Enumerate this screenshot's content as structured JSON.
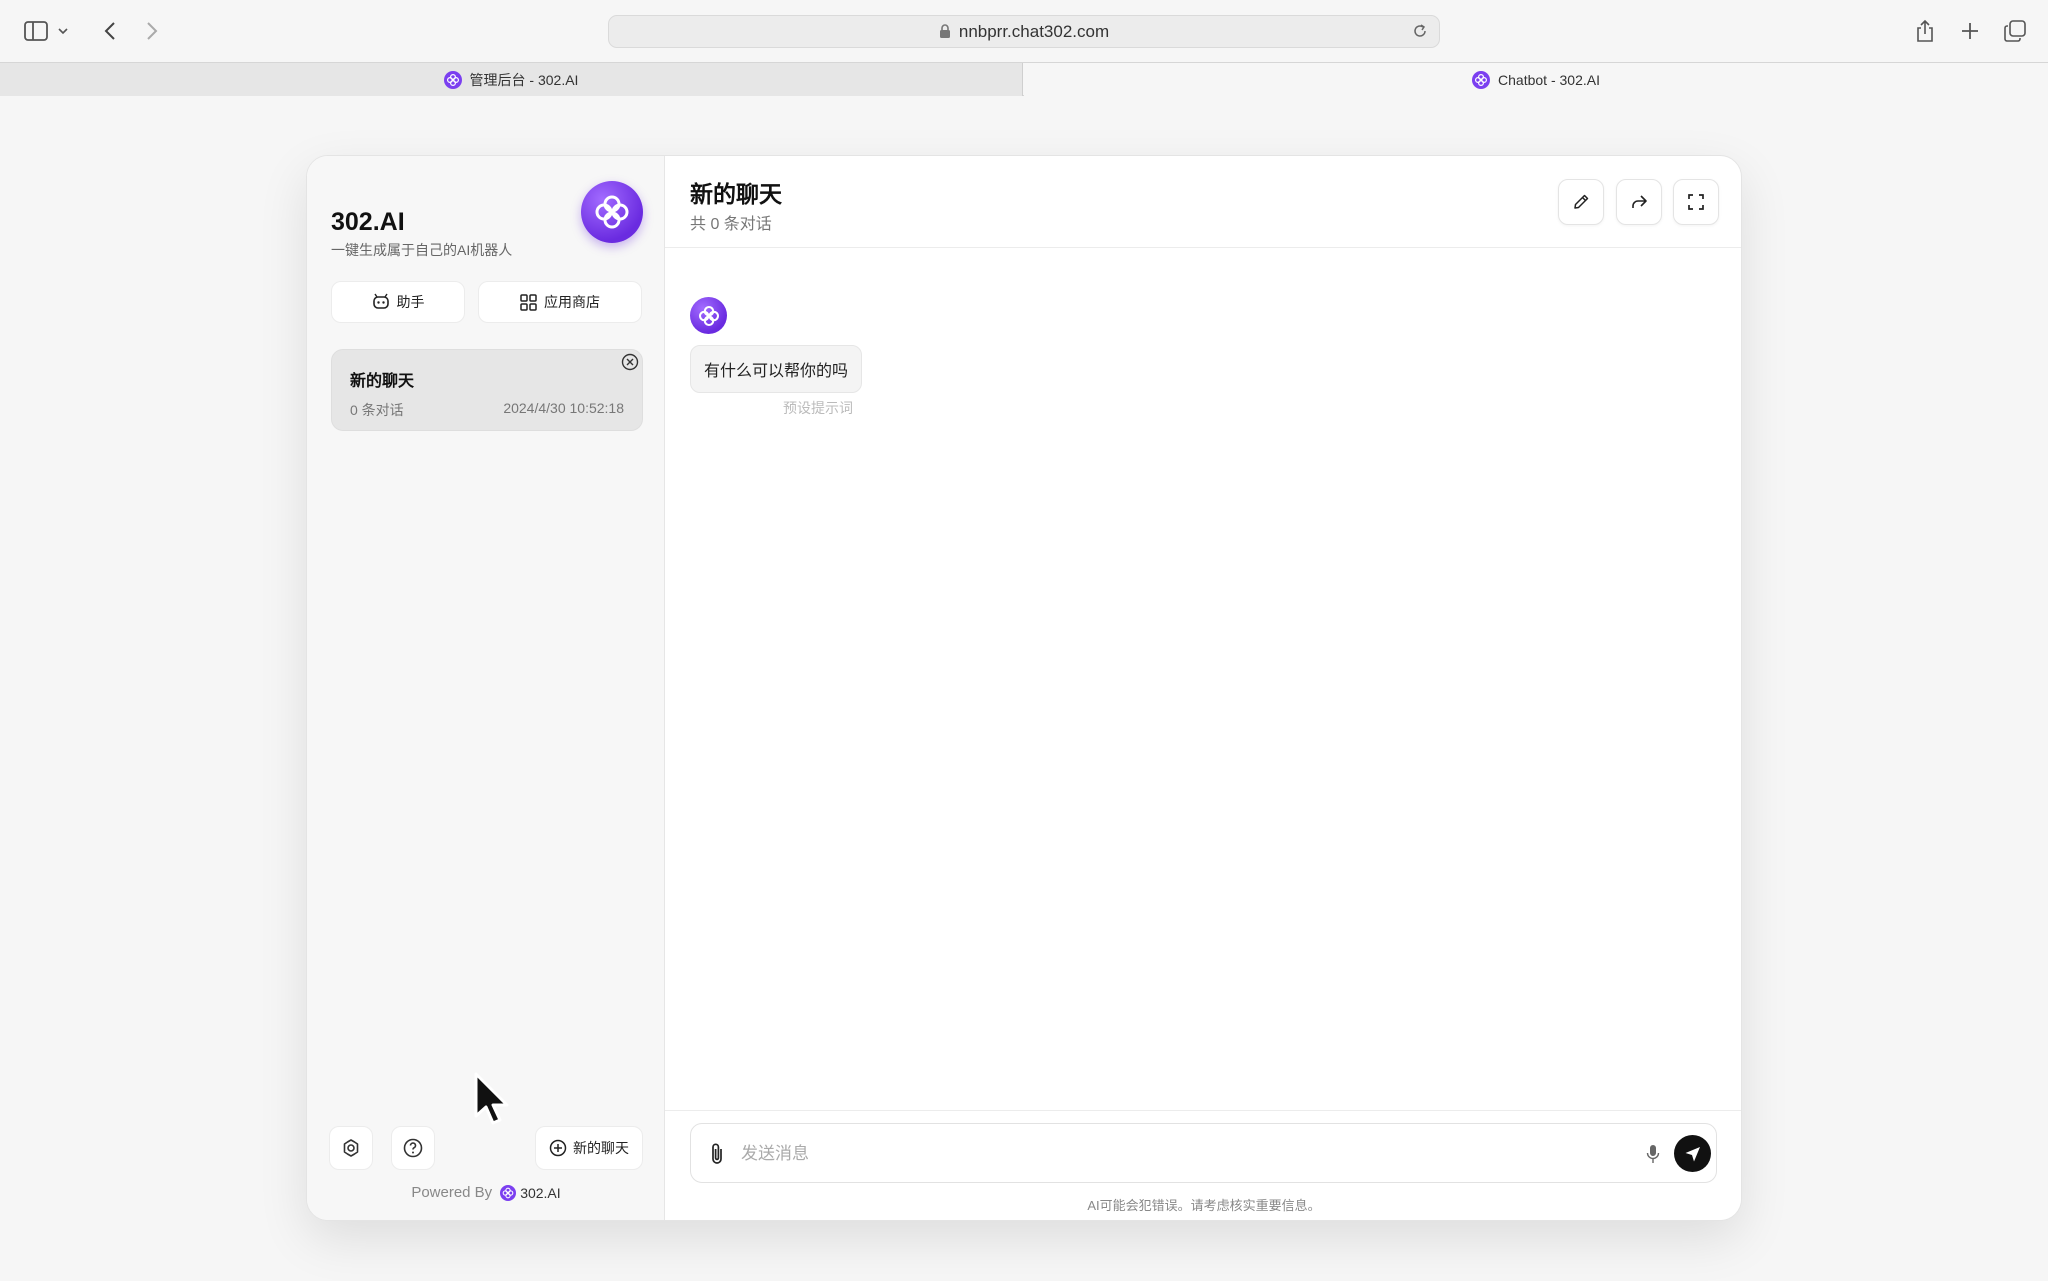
{
  "browser": {
    "url": "nnbprr.chat302.com",
    "tabs": [
      {
        "label": "管理后台 - 302.AI",
        "active": false
      },
      {
        "label": "Chatbot - 302.AI",
        "active": true
      }
    ]
  },
  "sidebar": {
    "brand_title": "302.AI",
    "brand_subtitle": "一键生成属于自己的AI机器人",
    "assistant_label": "助手",
    "app_store_label": "应用商店",
    "chats": [
      {
        "title": "新的聊天",
        "count": "0 条对话",
        "time": "2024/4/30 10:52:18"
      }
    ],
    "new_chat_label": "新的聊天",
    "powered_by": "Powered By",
    "powered_brand": "302.AI"
  },
  "main": {
    "title": "新的聊天",
    "subtitle": "共 0 条对话",
    "messages": [
      {
        "role": "bot",
        "text": "有什么可以帮你的吗",
        "note": "预设提示词"
      }
    ],
    "input_placeholder": "发送消息",
    "disclaimer": "AI可能会犯错误。请考虑核实重要信息。"
  },
  "colors": {
    "accent": "#7b3ff0",
    "send_button": "#111111"
  }
}
